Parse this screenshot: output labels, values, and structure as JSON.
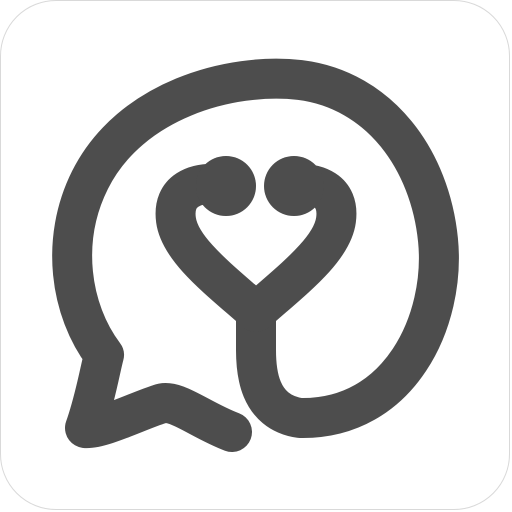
{
  "app_icon": {
    "icon": "chat-bubble-stethoscope-icon",
    "colors": {
      "stroke": "#4d4d4d",
      "tile_background": "#ffffff",
      "tile_border": "#d9d9d9"
    }
  }
}
